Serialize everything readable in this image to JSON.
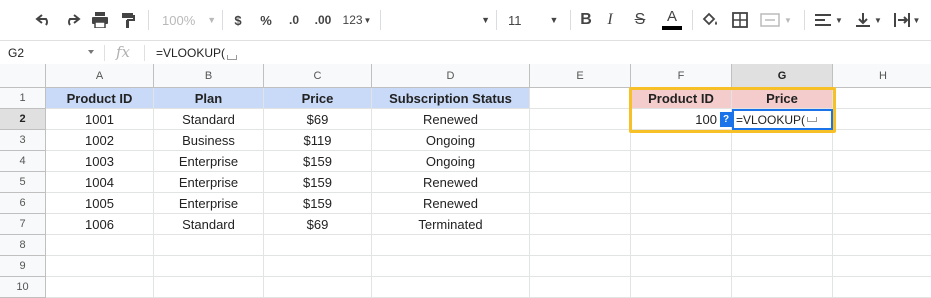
{
  "toolbar": {
    "zoom": "100%",
    "currency": "$",
    "percent": "%",
    "decrease_decimals": ".0",
    "increase_decimals": ".00",
    "more_formats": "123",
    "font_size": "11"
  },
  "formula_bar": {
    "cell_ref": "G2",
    "fx_label": "fx",
    "formula": "=VLOOKUP("
  },
  "columns": [
    "A",
    "B",
    "C",
    "D",
    "E",
    "F",
    "G",
    "H"
  ],
  "rows": [
    "1",
    "2",
    "3",
    "4",
    "5",
    "6",
    "7",
    "8",
    "9",
    "10"
  ],
  "table": {
    "headers": [
      "Product ID",
      "Plan",
      "Price",
      "Subscription Status"
    ],
    "rows": [
      [
        "1001",
        "Standard",
        "$69",
        "Renewed"
      ],
      [
        "1002",
        "Business",
        "$119",
        "Ongoing"
      ],
      [
        "1003",
        "Enterprise",
        "$159",
        "Ongoing"
      ],
      [
        "1004",
        "Enterprise",
        "$159",
        "Renewed"
      ],
      [
        "1005",
        "Enterprise",
        "$159",
        "Renewed"
      ],
      [
        "1006",
        "Standard",
        "$69",
        "Terminated"
      ]
    ]
  },
  "lookup": {
    "header_id": "Product ID",
    "header_price": "Price",
    "id_value": "100",
    "help_badge": "?",
    "editor_text": "=VLOOKUP("
  },
  "colors": {
    "header_blue": "#c9daf8",
    "header_pink": "#f4cccc",
    "highlight_yellow": "#f6c026",
    "selection_blue": "#1a73e8"
  }
}
